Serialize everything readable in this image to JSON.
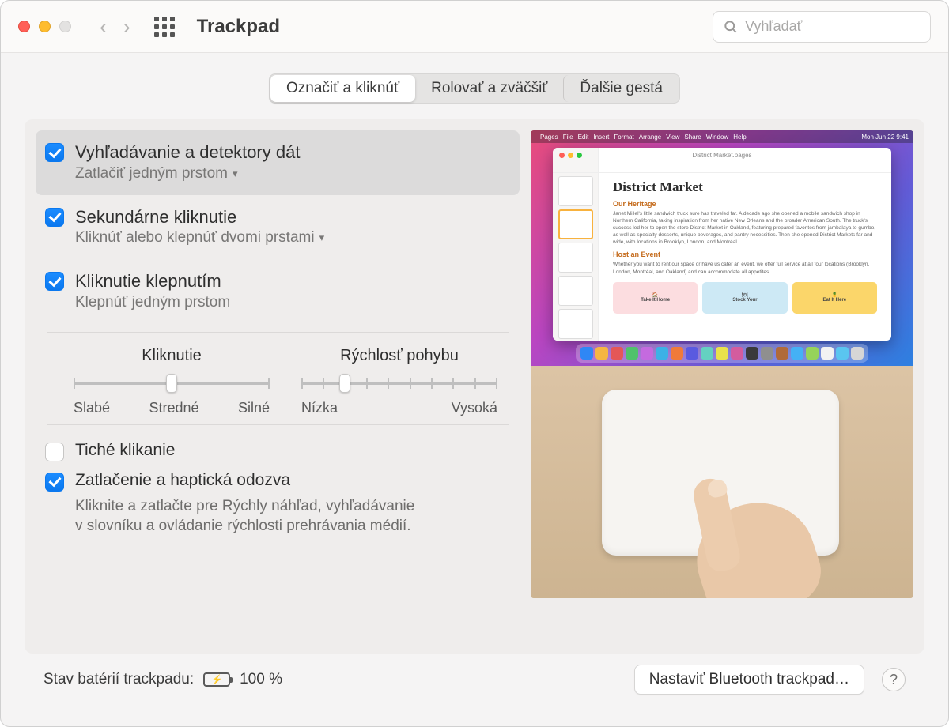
{
  "window": {
    "title": "Trackpad"
  },
  "search": {
    "placeholder": "Vyhľadať"
  },
  "tabs": [
    "Označiť a kliknúť",
    "Rolovať a zväčšiť",
    "Ďalšie gestá"
  ],
  "options": {
    "lookup": {
      "title": "Vyhľadávanie a detektory dát",
      "sub": "Zatlačiť jedným prstom",
      "checked": true
    },
    "secondary": {
      "title": "Sekundárne kliknutie",
      "sub": "Kliknúť alebo klepnúť dvomi prstami",
      "checked": true
    },
    "tap": {
      "title": "Kliknutie klepnutím",
      "sub": "Klepnúť jedným prstom",
      "checked": true
    }
  },
  "sliders": {
    "click": {
      "label": "Kliknutie",
      "lo": "Slabé",
      "mid": "Stredné",
      "hi": "Silné",
      "ticks": 3,
      "pos": 50
    },
    "speed": {
      "label": "Rýchlosť pohybu",
      "lo": "Nízka",
      "hi": "Vysoká",
      "ticks": 10,
      "pos": 22
    }
  },
  "bottom": {
    "silent": {
      "label": "Tiché klikanie",
      "checked": false
    },
    "force": {
      "label": "Zatlačenie a haptická odozva",
      "checked": true,
      "desc1": "Kliknite a zatlačte pre Rýchly náhľad, vyhľadávanie",
      "desc2": "v slovníku a ovládanie rýchlosti prehrávania médií."
    }
  },
  "preview": {
    "menubar_left": [
      "Pages",
      "File",
      "Edit",
      "Insert",
      "Format",
      "Arrange",
      "View",
      "Share",
      "Window",
      "Help"
    ],
    "menubar_right": "Mon Jun 22  9:41",
    "doc_filename": "District Market.pages",
    "doc_title": "District Market",
    "h_heritage": "Our Heritage",
    "p1": "Janet Millel's little sandwich truck sure has traveled far. A decade ago she opened a mobile sandwich shop in Northern California, taking inspiration from her native New Orleans and the broader American South. The truck's success led her to open the store District Market in Oakland, featuring prepared favorites from jambalaya to gumbo, as well as specialty desserts, unique beverages, and pantry necessities. Then she opened District Markets far and wide, with locations in Brooklyn, London, and Montréal.",
    "h_event": "Host an Event",
    "p2": "Whether you want to rent our space or have us cater an event, we offer full service at all four locations (Brooklyn, London, Montréal, and Oakland) and can accommodate all appetites.",
    "cards": [
      "Take It Home",
      "Stock Your",
      "Eat It Here"
    ]
  },
  "footer": {
    "battery_label": "Stav batérií trackpadu:",
    "battery_pct": "100 %",
    "bt_button": "Nastaviť Bluetooth trackpad…"
  }
}
